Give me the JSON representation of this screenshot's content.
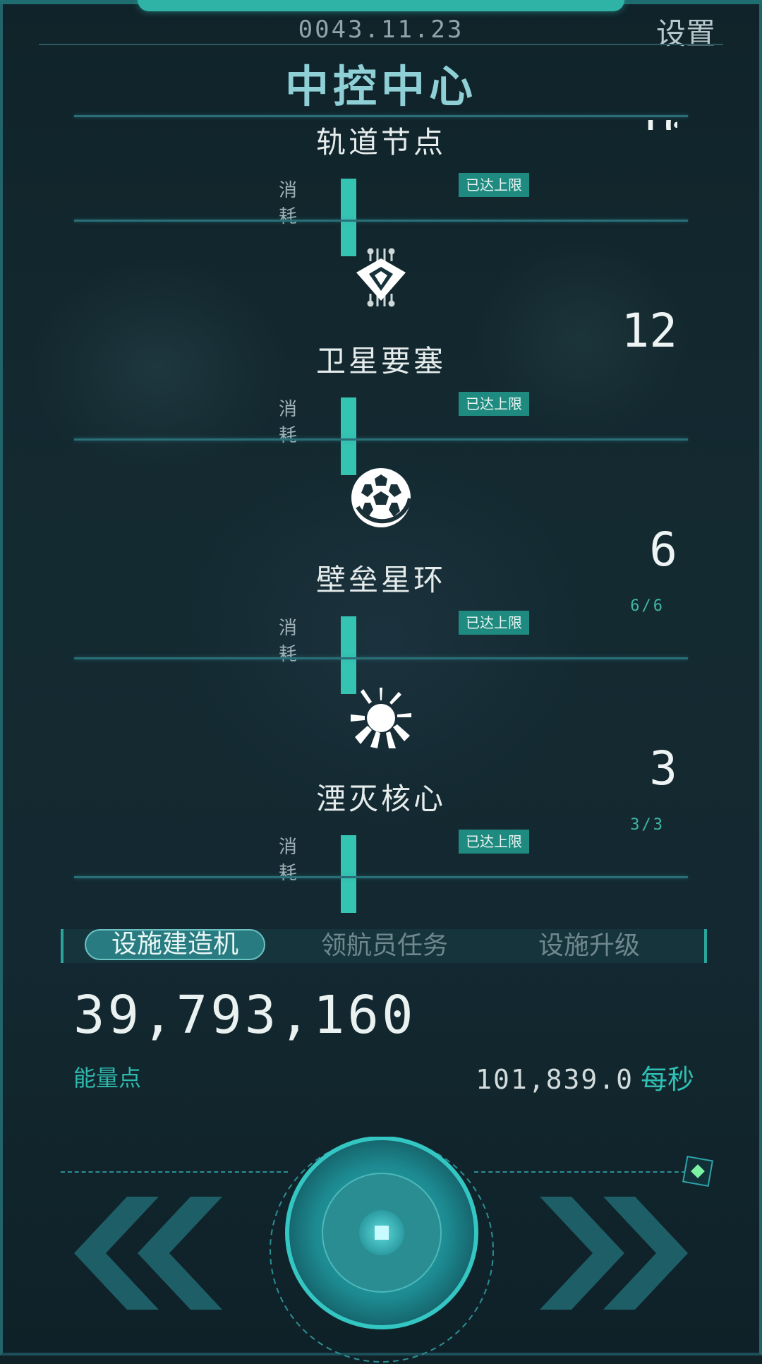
{
  "header": {
    "date": "0043.11.23",
    "settings_label": "设置",
    "title": "中控中心"
  },
  "facilities": [
    {
      "name": "轨道节点",
      "count": "",
      "sub": "",
      "cost_label": "消耗",
      "pips": 5,
      "status": "已达上限",
      "icon": "orbital-node-icon"
    },
    {
      "name": "卫星要塞",
      "count": "12",
      "sub": "",
      "cost_label": "消耗",
      "pips": 5,
      "status": "已达上限",
      "icon": "satellite-fortress-icon"
    },
    {
      "name": "壁垒星环",
      "count": "6",
      "sub": "6/6",
      "cost_label": "消耗",
      "pips": 5,
      "status": "已达上限",
      "icon": "barrier-ring-icon"
    },
    {
      "name": "湮灭核心",
      "count": "3",
      "sub": "3/3",
      "cost_label": "消耗",
      "pips": 5,
      "status": "已达上限",
      "icon": "annihilation-core-icon"
    }
  ],
  "tabs": [
    {
      "label": "设施建造机",
      "active": true
    },
    {
      "label": "领航员任务",
      "active": false
    },
    {
      "label": "设施升级",
      "active": false
    }
  ],
  "energy": {
    "value": "39,793,160",
    "label": "能量点",
    "rate": "101,839.0",
    "rate_unit": "每秒"
  },
  "colors": {
    "accent": "#35c3b2",
    "background": "#112128",
    "badge": "#1f8b80"
  }
}
